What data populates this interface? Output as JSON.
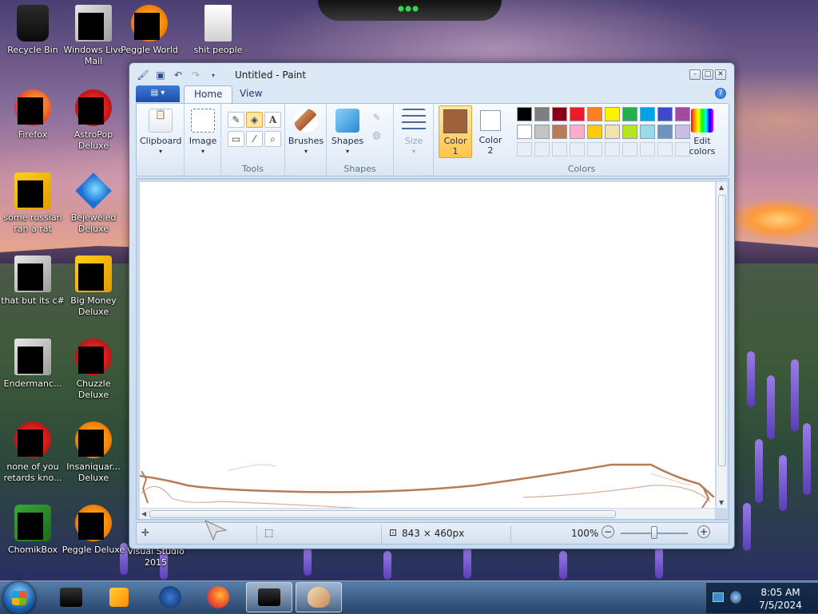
{
  "desktop": {
    "icons": [
      {
        "label": "Recycle Bin",
        "kind": "recycle-bin-icon"
      },
      {
        "label": "Windows Live Mail",
        "kind": "windows-live-mail-icon"
      },
      {
        "label": "Peggle World",
        "kind": "peggle-world-icon"
      },
      {
        "label": "shit people",
        "kind": "folder-icon"
      },
      {
        "label": "Firefox",
        "kind": "firefox-icon"
      },
      {
        "label": "AstroPop Deluxe",
        "kind": "astropop-icon"
      },
      {
        "label": "some russian ran a rat",
        "kind": "app-icon"
      },
      {
        "label": "Bejeweled Deluxe",
        "kind": "bejeweled-icon"
      },
      {
        "label": "that but its c#",
        "kind": "windows-icon"
      },
      {
        "label": "Big Money Deluxe",
        "kind": "big-money-icon"
      },
      {
        "label": "Endermanc...",
        "kind": "app-icon"
      },
      {
        "label": "Chuzzle Deluxe",
        "kind": "chuzzle-icon"
      },
      {
        "label": "none of you retards kno...",
        "kind": "opera-icon"
      },
      {
        "label": "Insaniquar... Deluxe",
        "kind": "insaniquarium-icon"
      },
      {
        "label": "ChomikBox",
        "kind": "chomikbox-icon"
      },
      {
        "label": "Peggle Deluxe",
        "kind": "peggle-icon"
      },
      {
        "label": "Visual Studio 2015",
        "kind": "visual-studio-icon"
      }
    ]
  },
  "window": {
    "title": "Untitled - Paint",
    "tabs": {
      "home": "Home",
      "view": "View"
    },
    "ribbon": {
      "clipboard": "Clipboard",
      "image": "Image",
      "tools_group": "Tools",
      "brushes": "Brushes",
      "shapes": "Shapes",
      "shapes_group": "Shapes",
      "size": "Size",
      "color1_line1": "Color",
      "color1_line2": "1",
      "color2_line1": "Color",
      "color2_line2": "2",
      "colors_group": "Colors",
      "edit_colors_line1": "Edit",
      "edit_colors_line2": "colors"
    },
    "color1_value": "#a0623b",
    "color2_value": "#ffffff",
    "palette_row1": [
      "#000000",
      "#7f7f7f",
      "#880015",
      "#ed1c24",
      "#ff7f27",
      "#fff200",
      "#22b14c",
      "#00a2e8",
      "#3f48cc",
      "#a349a4"
    ],
    "palette_row2": [
      "#ffffff",
      "#c3c3c3",
      "#b97a57",
      "#ffaec9",
      "#ffc90e",
      "#efe4b0",
      "#b5e61d",
      "#99d9ea",
      "#7092be",
      "#c8bfe7"
    ],
    "status": {
      "dimensions": "843 × 460px",
      "zoom": "100%"
    }
  },
  "taskbar": {
    "time": "8:05 AM",
    "date": "7/5/2024"
  }
}
